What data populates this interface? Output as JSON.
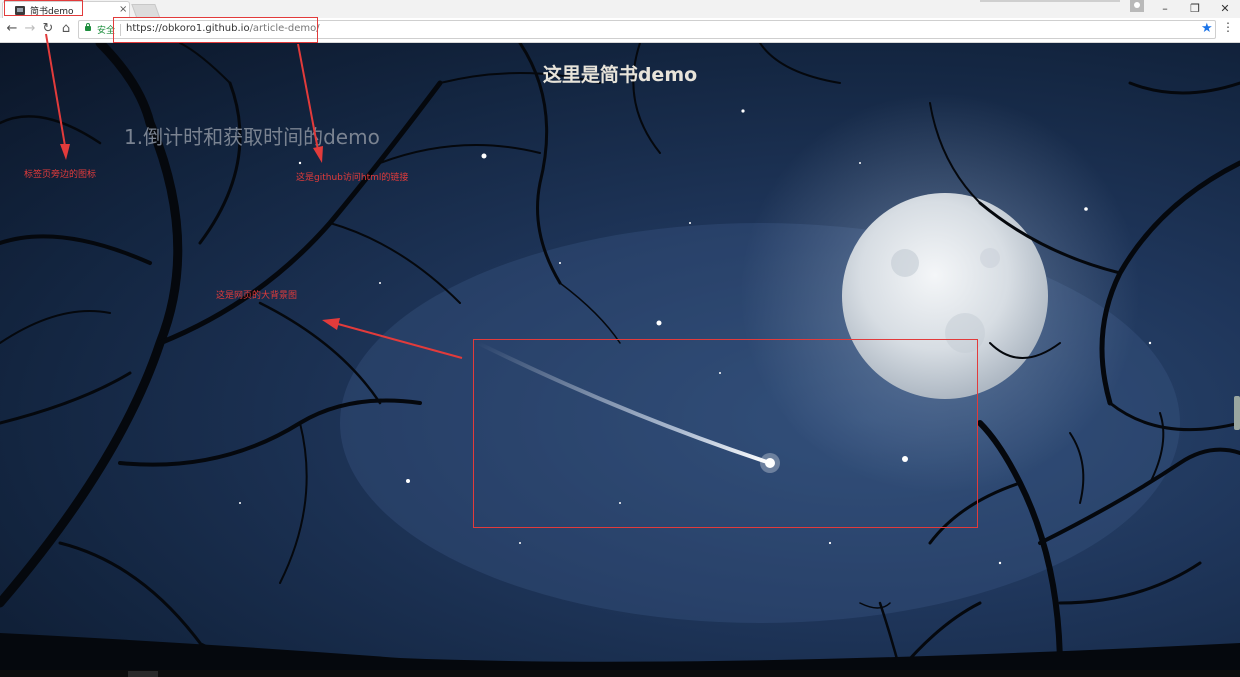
{
  "browser": {
    "tab_title": "简书demo",
    "tab_close": "×",
    "secure_label": "安全",
    "url_host": "https://obkoro1.github.io",
    "url_path": "/article-demo/",
    "window_controls": {
      "minimize": "–",
      "maximize": "❐",
      "close": "✕"
    },
    "nav": {
      "back": "←",
      "forward": "→",
      "reload": "↻",
      "home": "⌂",
      "bookmark": "★",
      "menu": "⋮"
    }
  },
  "page": {
    "heading": "这里是简书demo",
    "demo_title": "1.倒计时和获取时间的demo"
  },
  "annotations": {
    "tab_icon_label": "标签页旁边的图标",
    "github_url_label": "这是github访问html的链接",
    "background_label": "这是网页的大背景图"
  },
  "colors": {
    "annotation": "#e23b3b",
    "secure": "#1e8e3e",
    "sky": "#1f365b",
    "heading": "#e8e4da"
  }
}
